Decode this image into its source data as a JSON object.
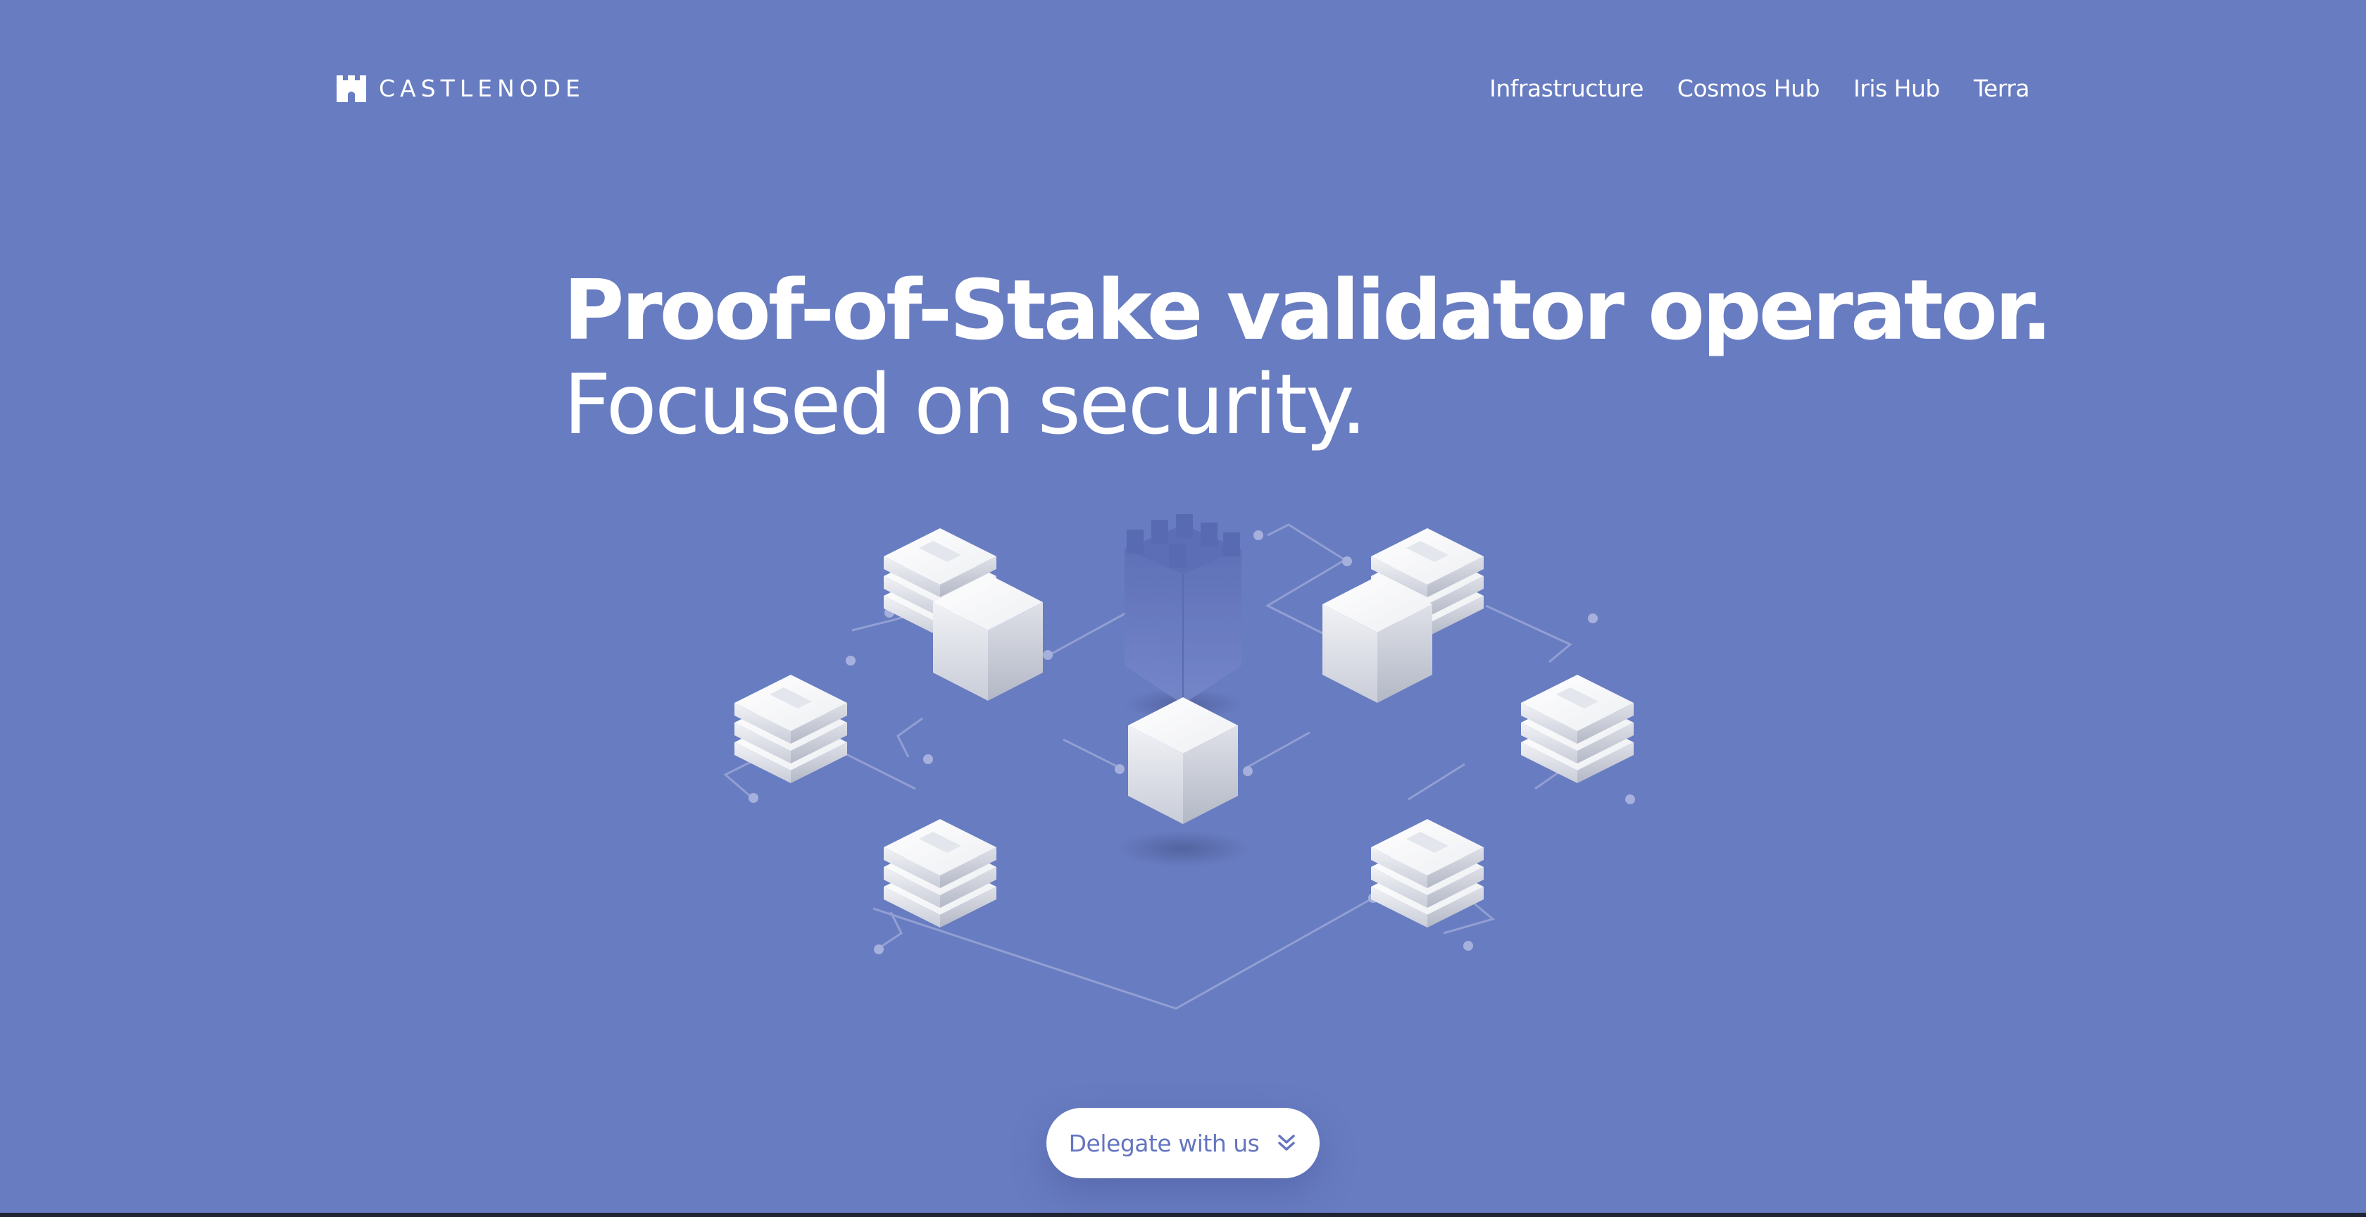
{
  "header": {
    "brand": {
      "name": "CASTLENODE",
      "icon": "castle-icon"
    },
    "nav": [
      {
        "label": "Infrastructure"
      },
      {
        "label": "Cosmos Hub"
      },
      {
        "label": "Iris Hub"
      },
      {
        "label": "Terra"
      }
    ]
  },
  "hero": {
    "title_line1": "Proof-of-Stake validator operator.",
    "title_line2": "Focused on security.",
    "illustration": "isometric-network-illustration"
  },
  "cta": {
    "label": "Delegate with us",
    "icon": "double-chevron-down-icon"
  },
  "colors": {
    "background": "#687cc1",
    "text": "#ffffff",
    "button_bg": "#ffffff",
    "button_text": "#6475c0"
  }
}
